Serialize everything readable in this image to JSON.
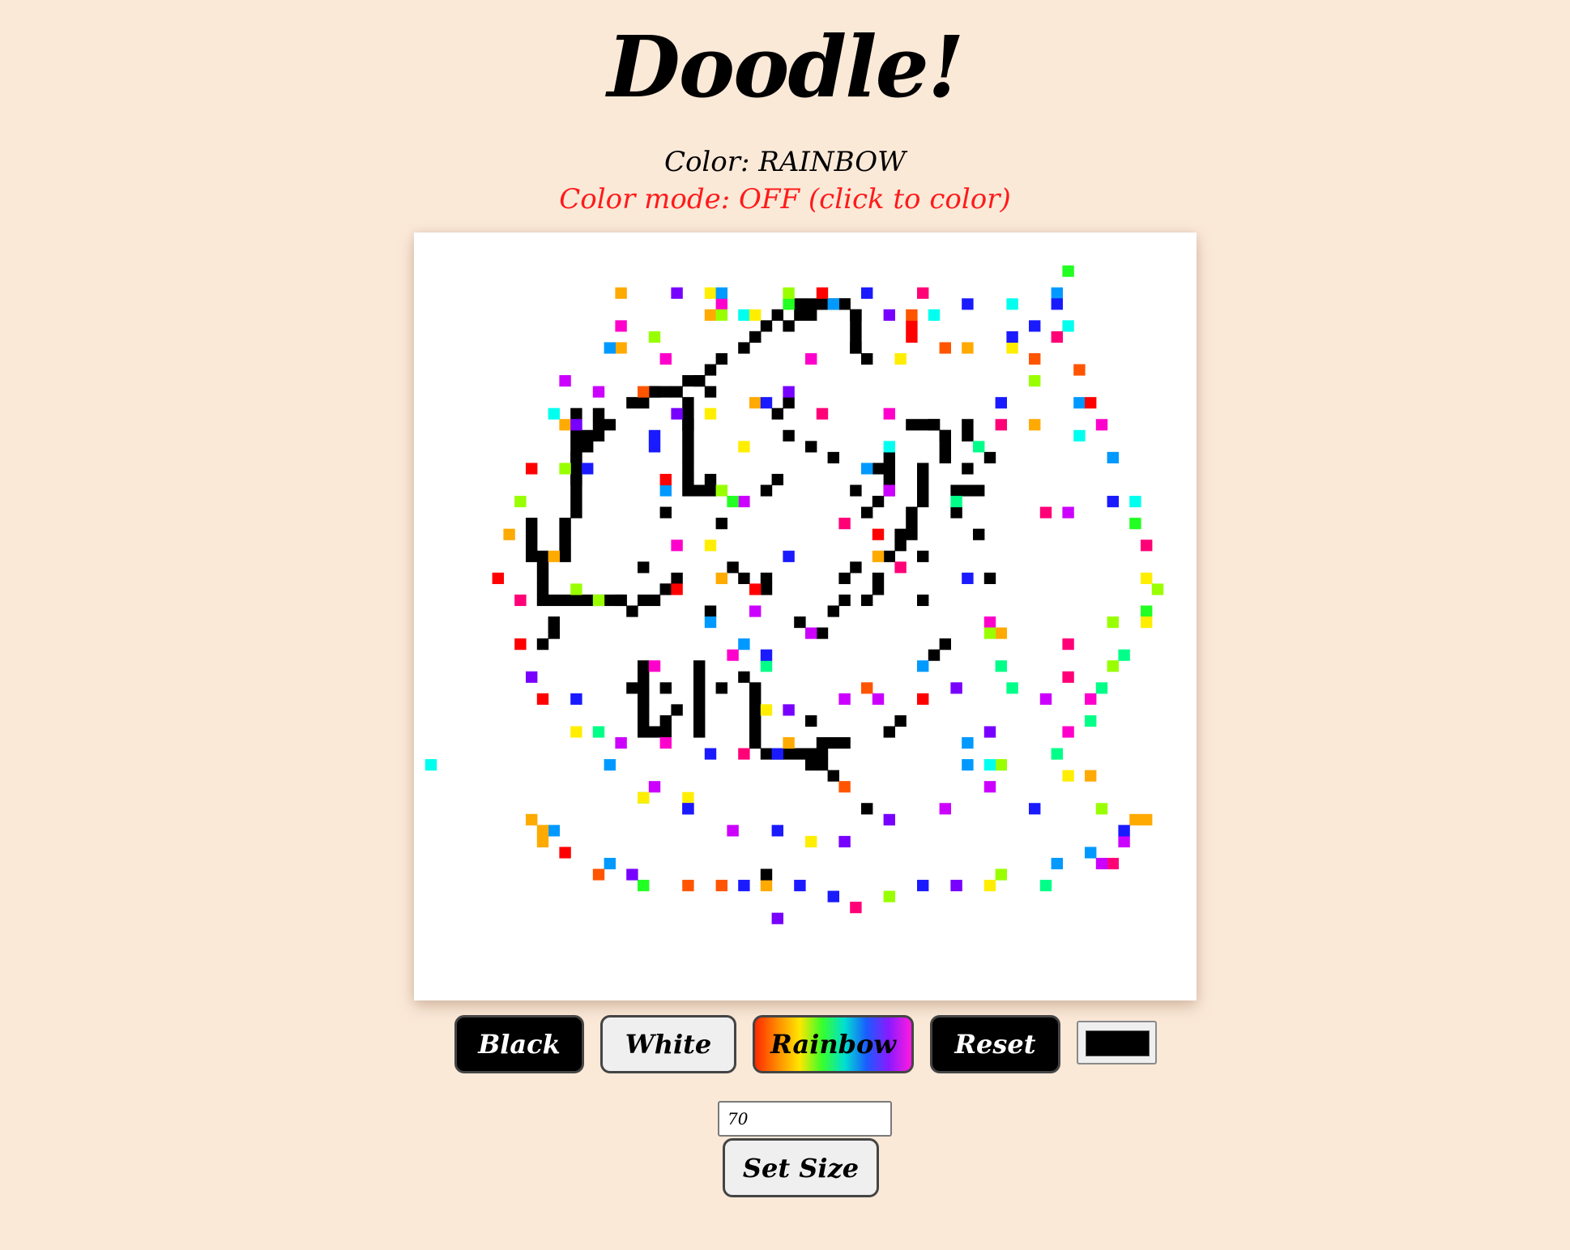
{
  "header": {
    "title": "Doodle!"
  },
  "status": {
    "color_text": "Color: RAINBOW",
    "mode_text": "Color mode: OFF (click to color)",
    "mode_color": "#ff1a1a"
  },
  "canvas": {
    "grid_size": 70,
    "background": "#ffffff",
    "palette": [
      "#000000",
      "#ff0000",
      "#ff5500",
      "#ffaa00",
      "#ffee00",
      "#99ff00",
      "#22ff22",
      "#00ff88",
      "#00ffee",
      "#0099ff",
      "#1a1aff",
      "#7700ff",
      "#cc00ff",
      "#ff00cc",
      "#ff0077"
    ]
  },
  "controls": {
    "black_label": "Black",
    "white_label": "White",
    "rainbow_label": "Rainbow",
    "reset_label": "Reset",
    "picker_value": "#000000",
    "size_value": "70",
    "set_size_label": "Set Size"
  }
}
